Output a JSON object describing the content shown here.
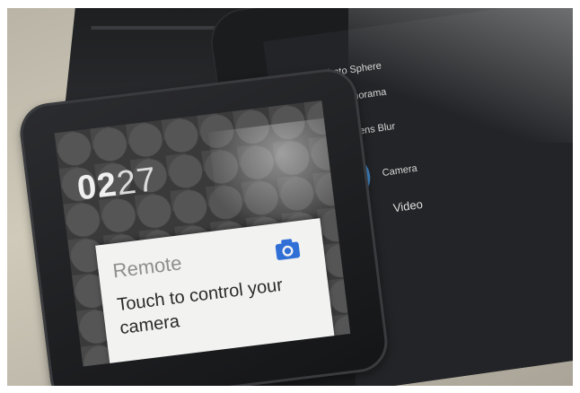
{
  "phone": {
    "menu": [
      {
        "label": "Photo Sphere",
        "icon": "photo-sphere-icon"
      },
      {
        "label": "Panorama",
        "icon": "panorama-icon"
      },
      {
        "label": "Lens Blur",
        "icon": "lens-blur-icon"
      },
      {
        "label": "Camera",
        "icon": "camera-icon",
        "active": true
      },
      {
        "label": "Video",
        "icon": "video-icon"
      }
    ],
    "accent_color": "#3f88c9"
  },
  "watch": {
    "time_hours": "02",
    "time_minutes": "27",
    "card": {
      "title": "Remote",
      "body": "Touch to control your camera",
      "icon": "camera-icon",
      "icon_color": "#2f6fd6"
    }
  }
}
